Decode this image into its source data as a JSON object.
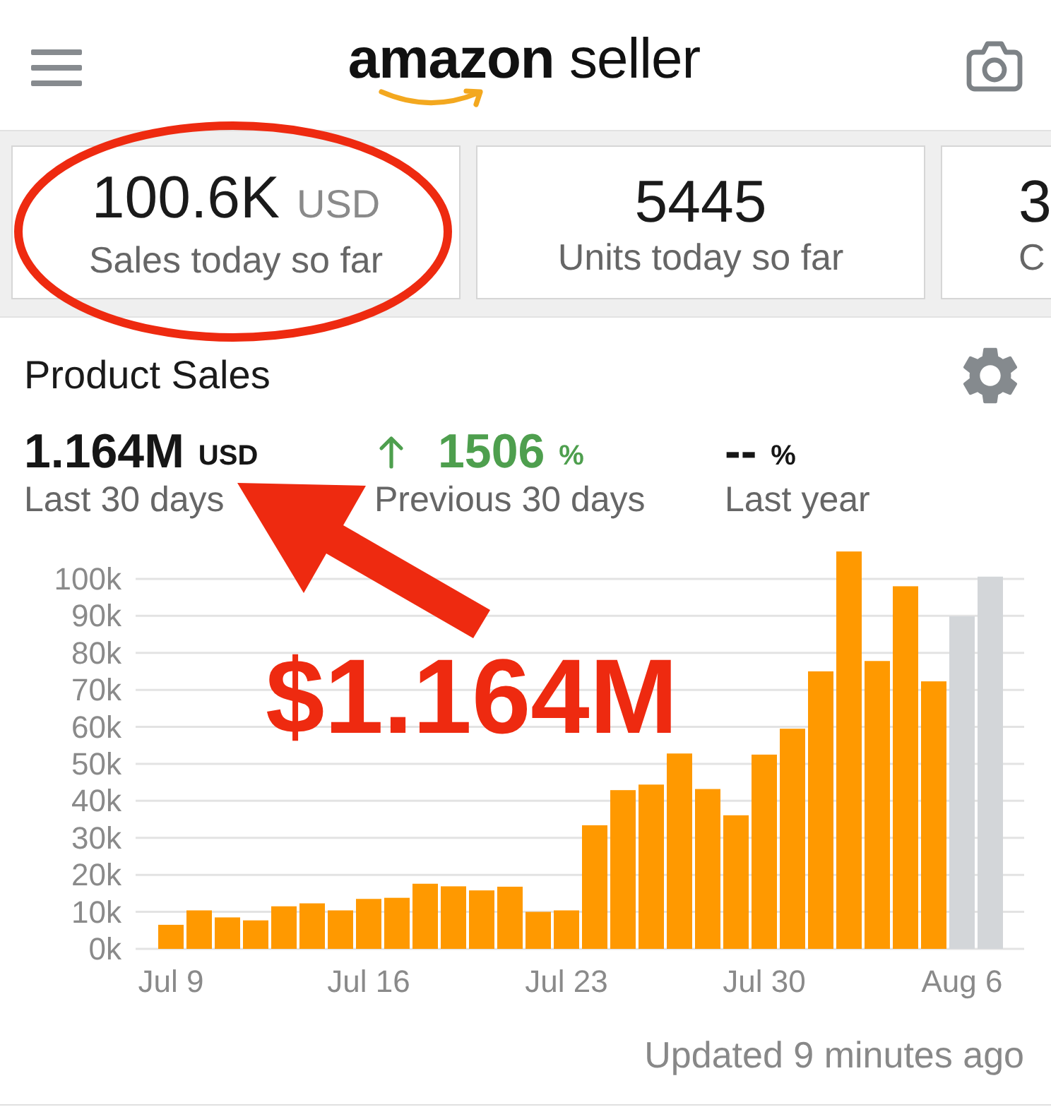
{
  "header": {
    "logo": "**amazon** seller"
  },
  "summary_cards": [
    {
      "value": "100.6K",
      "unit": "USD",
      "label": "Sales today so far"
    },
    {
      "value": "5445",
      "label": "Units today so far"
    },
    {
      "value": "3",
      "label": "C"
    }
  ],
  "product_sales": {
    "title": "Product Sales",
    "metrics": [
      {
        "value": "1.164M",
        "unit": "USD",
        "label": "Last 30 days",
        "increase": false
      },
      {
        "value": "1506",
        "unit": "%",
        "label": "Previous 30 days",
        "increase": true
      },
      {
        "value": "--",
        "unit": "%",
        "label": "Last year",
        "increase": false
      }
    ],
    "chart_data": {
      "type": "bar",
      "ylim": [
        0,
        108000
      ],
      "grid": true,
      "yticks": [
        {
          "value": 0,
          "label": "0k"
        },
        {
          "value": 10000,
          "label": "10k"
        },
        {
          "value": 20000,
          "label": "20k"
        },
        {
          "value": 30000,
          "label": "30k"
        },
        {
          "value": 40000,
          "label": "40k"
        },
        {
          "value": 50000,
          "label": "50k"
        },
        {
          "value": 60000,
          "label": "60k"
        },
        {
          "value": 70000,
          "label": "70k"
        },
        {
          "value": 80000,
          "label": "80k"
        },
        {
          "value": 90000,
          "label": "90k"
        },
        {
          "value": 100000,
          "label": "100k"
        }
      ],
      "categories": [
        "Jul 9",
        null,
        null,
        null,
        null,
        null,
        null,
        "Jul 16",
        null,
        null,
        null,
        null,
        null,
        null,
        "Jul 23",
        null,
        null,
        null,
        null,
        null,
        null,
        "Jul 30",
        null,
        null,
        null,
        null,
        null,
        null,
        "Aug 6",
        null
      ],
      "series": [
        {
          "color": "#ff9900",
          "values": [
            6500,
            10400,
            8500,
            7700,
            11500,
            12300,
            10400,
            13500,
            13800,
            17600,
            16900,
            15800,
            16800,
            10000,
            10400,
            33400,
            42900,
            44400,
            52800,
            43200,
            36100,
            52500,
            59500,
            75000,
            107400,
            77800,
            98000,
            72300,
            null,
            null
          ]
        },
        {
          "color": "#d3d6d9",
          "values": [
            null,
            null,
            null,
            null,
            null,
            null,
            null,
            null,
            null,
            null,
            null,
            null,
            null,
            null,
            null,
            null,
            null,
            null,
            null,
            null,
            null,
            null,
            null,
            null,
            null,
            null,
            null,
            null,
            89900,
            100600
          ]
        }
      ]
    }
  },
  "updated": "Updated 9 minutes ago",
  "annotation": {
    "text": "$1.164M"
  }
}
